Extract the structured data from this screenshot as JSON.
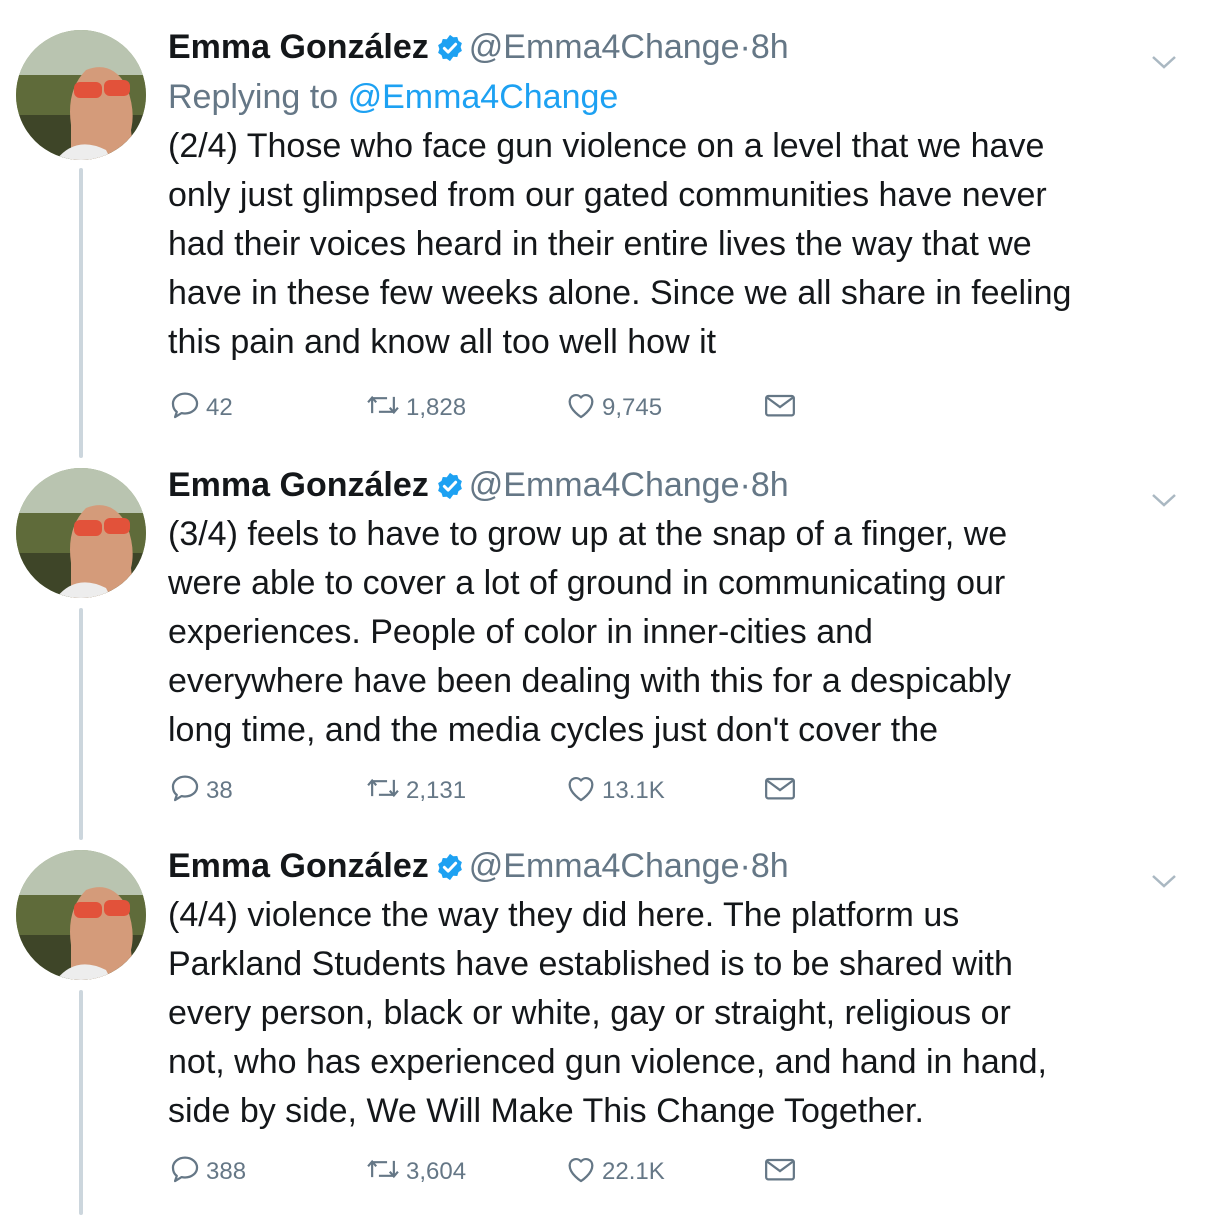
{
  "colors": {
    "link": "#1da1f2",
    "muted": "#657786",
    "text": "#14171a",
    "thread_line": "#ccd6dd",
    "verified": "#1da1f2"
  },
  "tweets": [
    {
      "name": "Emma González",
      "handle": "@Emma4Change",
      "dot": "·",
      "time": "8h",
      "reply_prefix": "Replying to",
      "reply_to": "@Emma4Change",
      "text": "(2/4) Those who face gun violence on a level that we have\nonly just glimpsed from our gated communities have never\nhad their voices heard in their entire lives the way that we\nhave in these few weeks alone. Since we all share in feeling\nthis pain and know all too well how it",
      "replies": "42",
      "retweets": "1,828",
      "likes": "9,745"
    },
    {
      "name": "Emma González",
      "handle": "@Emma4Change",
      "dot": "·",
      "time": "8h",
      "text": "(3/4) feels to have to grow up at the snap of a finger, we\nwere able to cover a lot of ground in communicating our\nexperiences.  People of color in inner-cities and\neverywhere have been dealing with this for a despicably\nlong time, and the media cycles just don't cover the",
      "replies": "38",
      "retweets": "2,131",
      "likes": "13.1K"
    },
    {
      "name": "Emma González",
      "handle": "@Emma4Change",
      "dot": "·",
      "time": "8h",
      "text": "(4/4) violence the way they did here.  The platform us\nParkland Students have established is to be shared with\nevery person, black or white, gay or straight, religious or\nnot, who has experienced gun violence, and hand in hand,\nside by side, We Will Make This Change Together.",
      "replies": "388",
      "retweets": "3,604",
      "likes": "22.1K"
    }
  ],
  "icons": {
    "reply": "reply-icon",
    "retweet": "retweet-icon",
    "like": "heart-icon",
    "dm": "mail-icon",
    "verified": "verified-badge-icon",
    "caret": "chevron-down-icon"
  }
}
